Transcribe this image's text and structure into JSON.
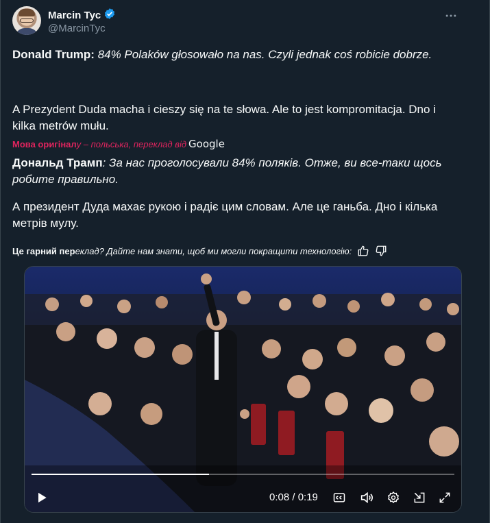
{
  "author": {
    "display_name": "Marcin Tyc",
    "handle": "@MarcinTyc",
    "verified": true,
    "verified_color": "#1d9bf0"
  },
  "menu_icon": "more-horizontal-icon",
  "post": {
    "line1_speaker": "Donald Trump:",
    "line1_quote": "84% Polaków głosowało na nas. Czyli jednak coś robicie dobrze.",
    "line2": "A Prezydent Duda macha i cieszy się na te słowa. Ale to jest kompromitacja. Dno i kilka metrów mułu."
  },
  "translation": {
    "label_bold": "Мова оригінал",
    "label_rest": "у – польська, переклад від",
    "provider": "Google",
    "line1_speaker": "Дональд Трамп",
    "line1_quote": ": За нас проголосували 84% поляків. Отже, ви все-таки щось робите правильно.",
    "line2": "А президент Дуда махає рукою і радіє цим словам. Але це ганьба. Дно і кілька метрів мулу."
  },
  "feedback": {
    "bold": "Це гарний пер",
    "rest": "еклад? Дайте нам знати, щоб ми могли покращити технологію:",
    "icons": [
      "thumbs-up-icon",
      "thumbs-down-icon"
    ]
  },
  "video": {
    "current_time": "0:08",
    "duration": "0:19",
    "time_display": "0:08 / 0:19",
    "progress": 0.42,
    "icons": [
      "play-icon",
      "captions-icon",
      "volume-icon",
      "settings-icon",
      "pop-out-icon",
      "fullscreen-icon"
    ]
  }
}
